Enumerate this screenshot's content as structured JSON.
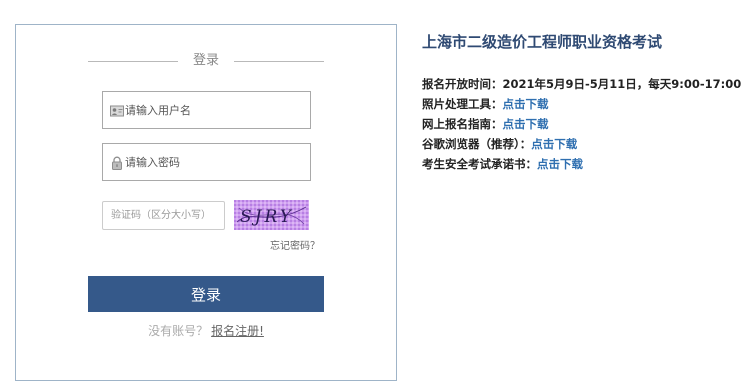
{
  "login": {
    "heading": "登录",
    "username_placeholder": "请输入用户名",
    "password_placeholder": "请输入密码",
    "captcha_placeholder": "验证码（区分大小写）",
    "captcha_text": "SJRY",
    "forgot_password": "忘记密码？",
    "login_button": "登录",
    "no_account_text": "没有账号？",
    "register_link": "报名注册!"
  },
  "info": {
    "title": "上海市二级造价工程师职业资格考试",
    "rows": [
      {
        "label": "报名开放时间：",
        "value": "2021年5月9日-5月11日，每天9:00-17:00",
        "link": ""
      },
      {
        "label": "照片处理工具：",
        "value": "",
        "link": "点击下载"
      },
      {
        "label": "网上报名指南：",
        "value": "",
        "link": "点击下载"
      },
      {
        "label": "谷歌浏览器（推荐）：",
        "value": "",
        "link": "点击下载"
      },
      {
        "label": "考生安全考试承诺书：",
        "value": "",
        "link": "点击下载"
      }
    ]
  },
  "colors": {
    "primary_button": "#35598a",
    "panel_border": "#9fb4c8",
    "title": "#2f4a73",
    "link": "#2f6fb0",
    "captcha_bg": "#cf9ff0"
  },
  "icons": [
    "user-icon",
    "lock-icon"
  ]
}
